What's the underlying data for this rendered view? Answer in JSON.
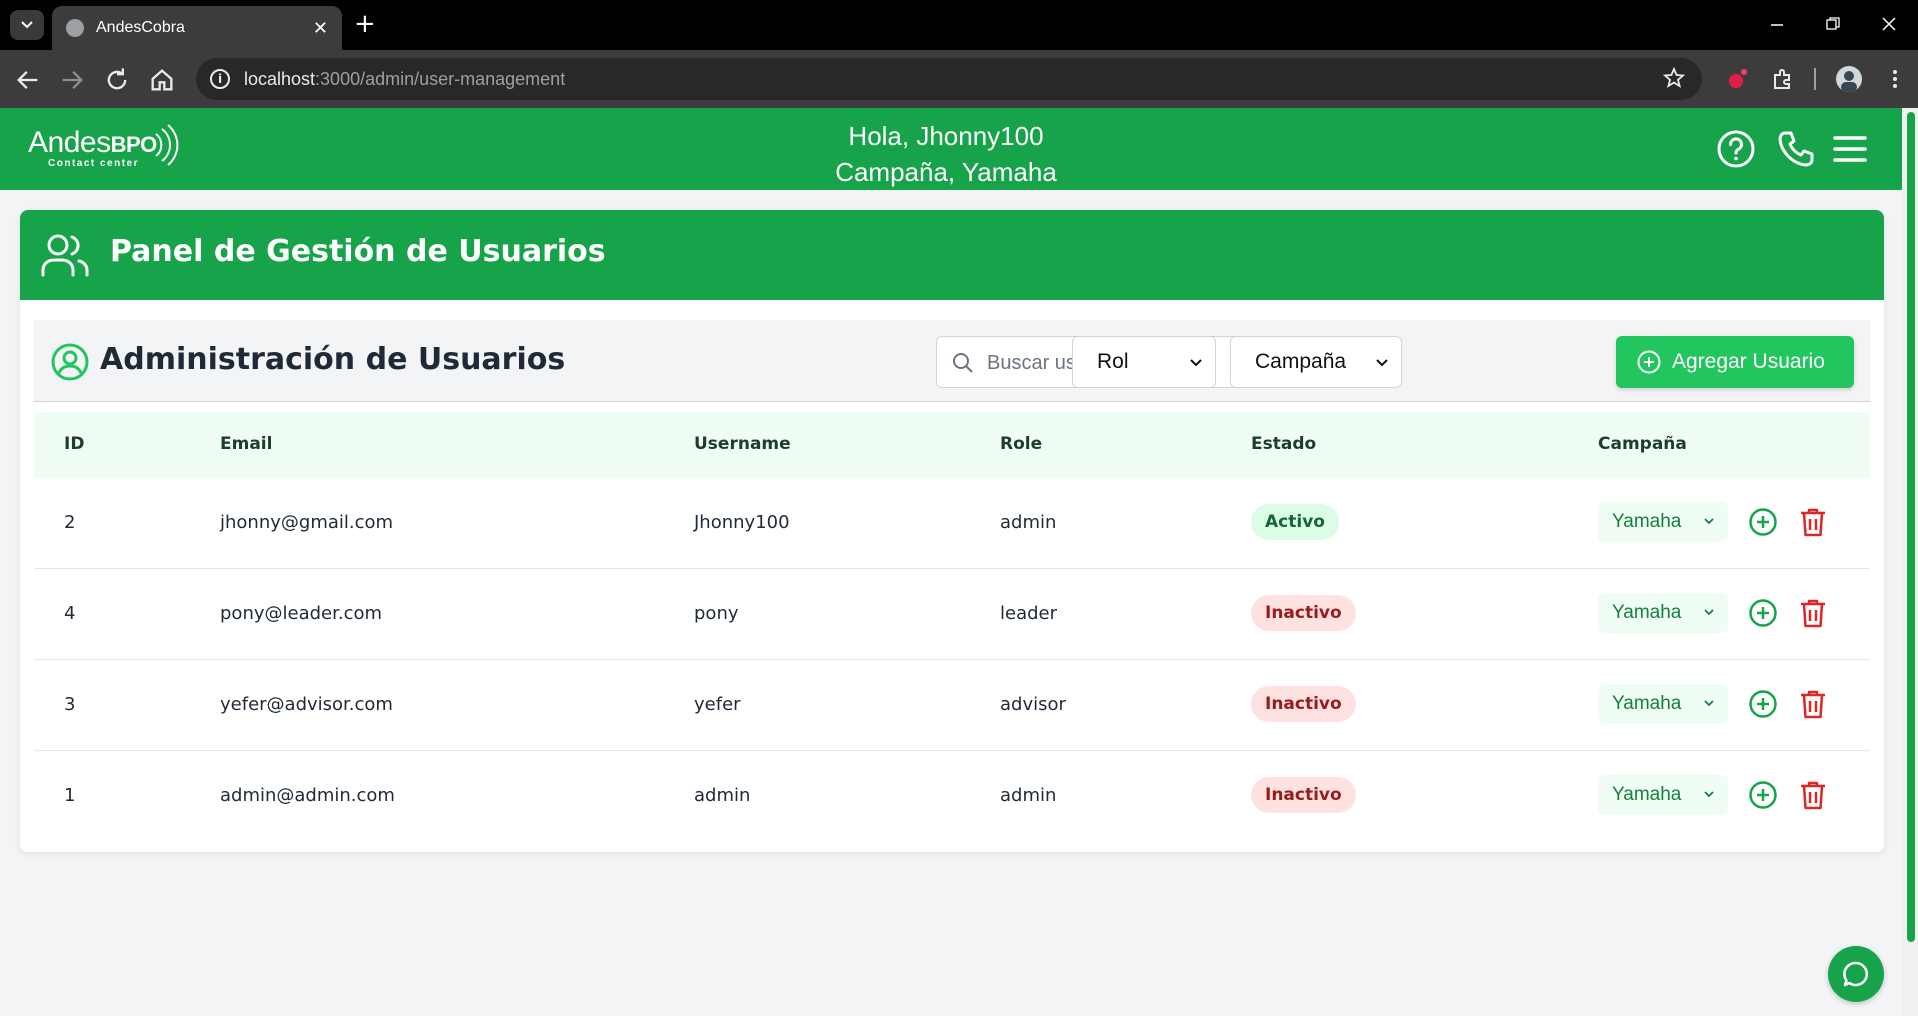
{
  "browser": {
    "tab_title": "AndesCobra",
    "url_host": "localhost",
    "url_rest": ":3000/admin/user-management",
    "new_tab": "+",
    "close_tab": "✕"
  },
  "header": {
    "logo_text": "Andes",
    "logo_bpo": "BPO",
    "logo_sub": "Contact center",
    "greeting": "Hola, Jhonny100",
    "campaign": "Campaña, Yamaha"
  },
  "panel": {
    "title": "Panel de Gestión de Usuarios",
    "subtitle": "Administración de Usuarios",
    "search_placeholder": "Buscar usuarios...",
    "role_select": "Rol",
    "campaign_select": "Campaña",
    "add_button": "Agregar Usuario"
  },
  "table": {
    "headers": [
      "ID",
      "Email",
      "Username",
      "Role",
      "Estado",
      "Campaña"
    ],
    "rows": [
      {
        "id": "2",
        "email": "jhonny@gmail.com",
        "username": "Jhonny100",
        "role": "admin",
        "status": "Activo",
        "campaign": "Yamaha"
      },
      {
        "id": "4",
        "email": "pony@leader.com",
        "username": "pony",
        "role": "leader",
        "status": "Inactivo",
        "campaign": "Yamaha"
      },
      {
        "id": "3",
        "email": "yefer@advisor.com",
        "username": "yefer",
        "role": "advisor",
        "status": "Inactivo",
        "campaign": "Yamaha"
      },
      {
        "id": "1",
        "email": "admin@admin.com",
        "username": "admin",
        "role": "admin",
        "status": "Inactivo",
        "campaign": "Yamaha"
      }
    ]
  },
  "colors": {
    "brand_green": "#16a34a",
    "button_green": "#22c55e",
    "active_bg": "#dcfce7",
    "inactive_bg": "#fee2e2",
    "delete_red": "#dc2626"
  }
}
